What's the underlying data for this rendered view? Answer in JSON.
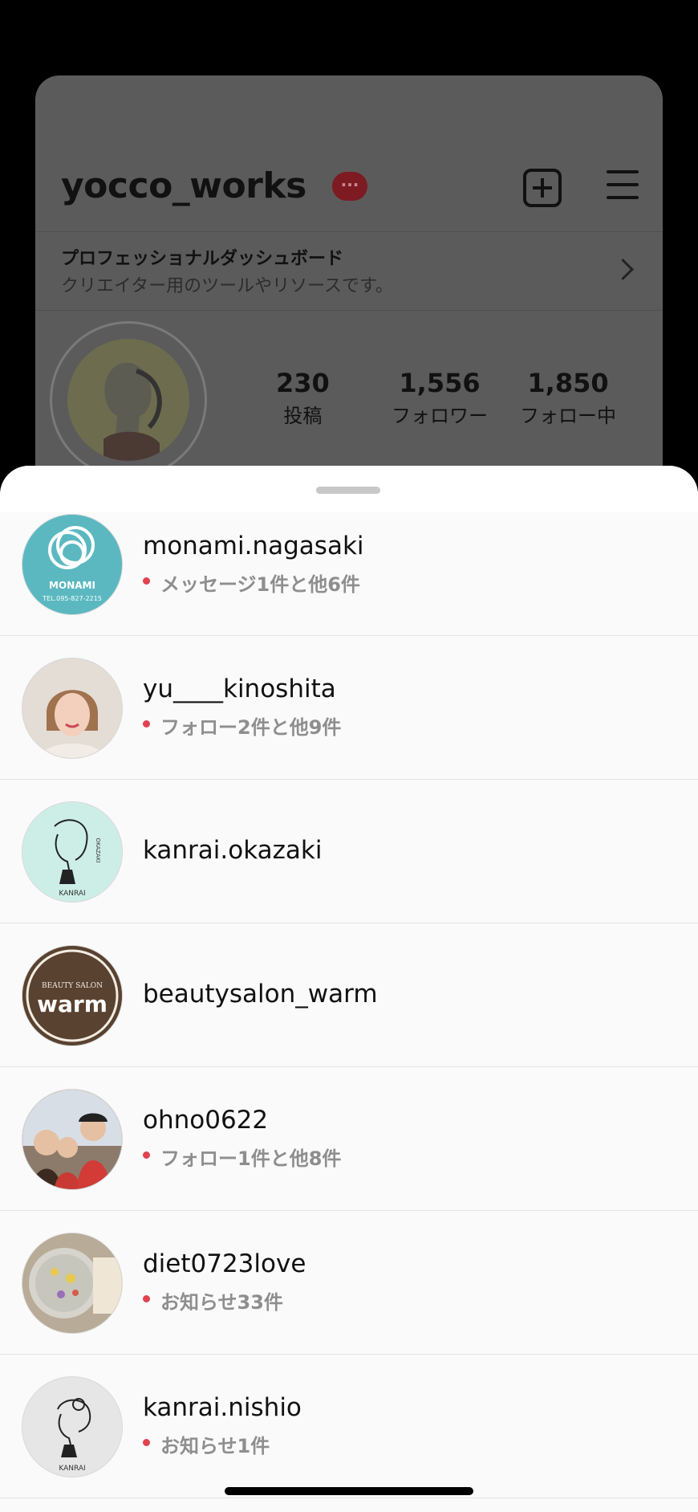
{
  "profile": {
    "username": "yocco_works",
    "badge": "···",
    "dashboard_title": "プロフェッショナルダッシュボード",
    "dashboard_subtitle": "クリエイター用のツールやリソースです。",
    "stats": [
      {
        "value": "230",
        "label": "投稿"
      },
      {
        "value": "1,556",
        "label": "フォロワー"
      },
      {
        "value": "1,850",
        "label": "フォロー中"
      }
    ]
  },
  "accounts": [
    {
      "username": "monami.nagasaki",
      "activity": "メッセージ1件と他6件",
      "avatar_color": "#5bb8c0"
    },
    {
      "username": "yu____kinoshita",
      "activity": "フォロー2件と他9件",
      "avatar_color": "#d9c9b8"
    },
    {
      "username": "kanrai.okazaki",
      "activity": "",
      "avatar_color": "#cdeee6"
    },
    {
      "username": "beautysalon_warm",
      "activity": "",
      "avatar_color": "#5a4230"
    },
    {
      "username": "ohno0622",
      "activity": "フォロー1件と他8件",
      "avatar_color": "#9c5b4d"
    },
    {
      "username": "diet0723love",
      "activity": "お知らせ33件",
      "avatar_color": "#b7a892"
    },
    {
      "username": "kanrai.nishio",
      "activity": "お知らせ1件",
      "avatar_color": "#e4e4e4"
    }
  ],
  "avatar_text": {
    "monami_brand": "MONAMI",
    "monami_tel": "TEL.095-827-2215",
    "kanrai": "KANRAI",
    "okazaki": "OKAZAKI",
    "warm_top": "BEAUTY SALON",
    "warm_main": "warm"
  },
  "colors": {
    "notification_dot": "#e0424f",
    "secondary_text": "#8e8e8e"
  }
}
